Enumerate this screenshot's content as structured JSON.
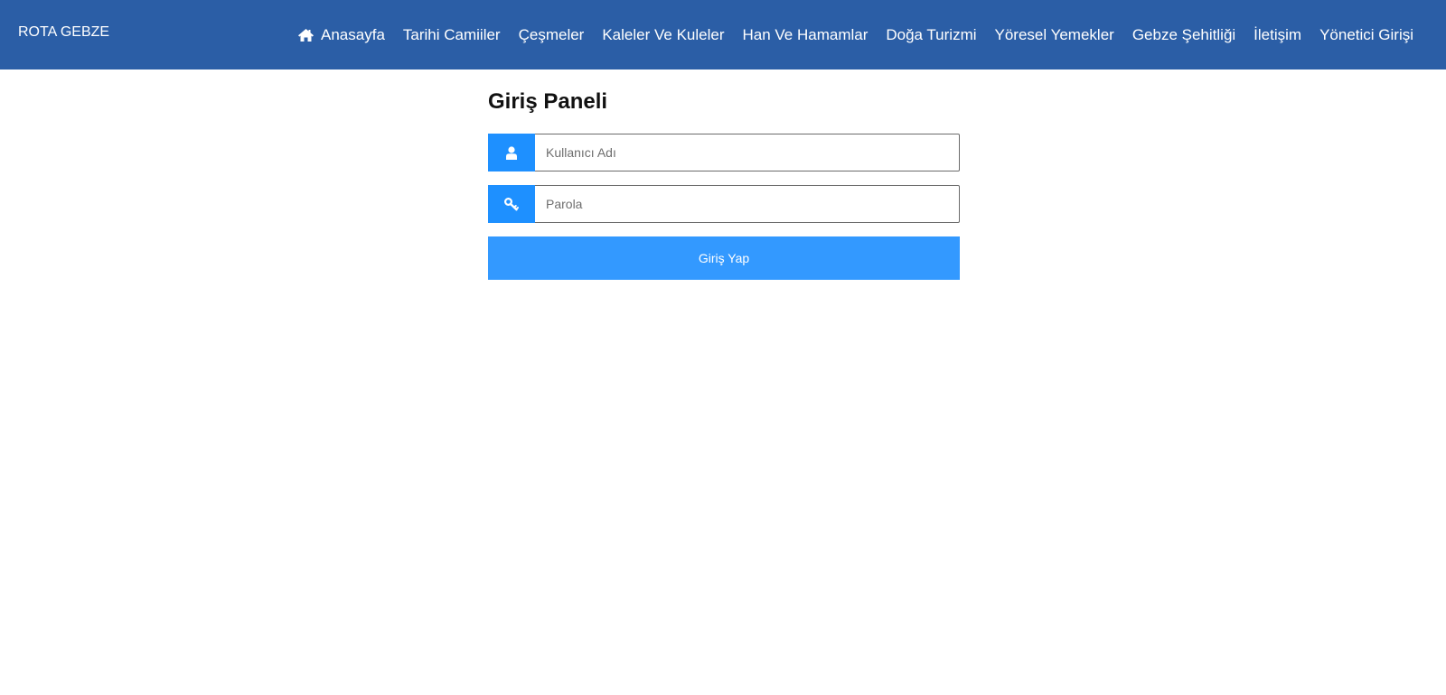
{
  "navbar": {
    "brand": "ROTA GEBZE",
    "links": [
      {
        "label": "Anasayfa",
        "icon": "home-icon"
      },
      {
        "label": "Tarihi Camiiler"
      },
      {
        "label": "Çeşmeler"
      },
      {
        "label": "Kaleler Ve Kuleler"
      },
      {
        "label": "Han Ve Hamamlar"
      },
      {
        "label": "Doğa Turizmi"
      },
      {
        "label": "Yöresel Yemekler"
      },
      {
        "label": "Gebze Şehitliği"
      },
      {
        "label": "İletişim"
      },
      {
        "label": "Yönetici Girişi"
      }
    ]
  },
  "login": {
    "title": "Giriş Paneli",
    "username": {
      "placeholder": "Kullanıcı Adı",
      "value": "",
      "icon": "user-icon"
    },
    "password": {
      "placeholder": "Parola",
      "value": "",
      "icon": "key-icon"
    },
    "submit_label": "Giriş Yap"
  },
  "colors": {
    "navbar_bg": "#2b5ea6",
    "addon_bg": "#1e90ff",
    "button_bg": "#3399ff",
    "text_light": "#ffffff"
  }
}
